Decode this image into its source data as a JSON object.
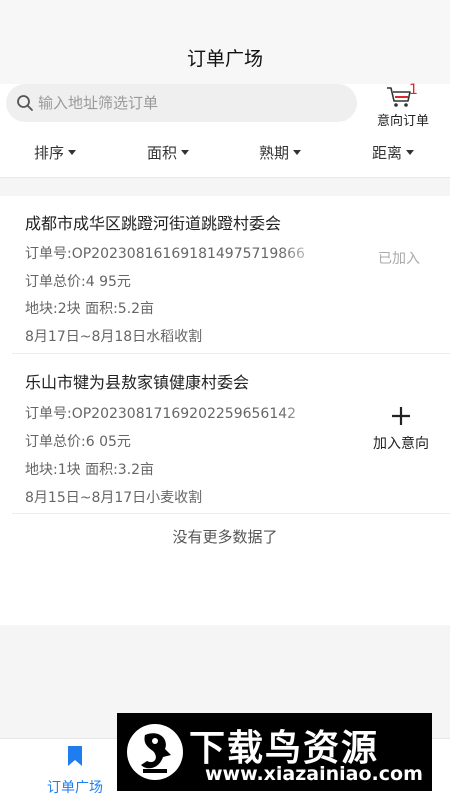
{
  "header": {
    "title": "订单广场"
  },
  "search": {
    "placeholder": "输入地址筛选订单"
  },
  "cart": {
    "badge": "1",
    "label": "意向订单"
  },
  "filters": [
    {
      "label": "排序"
    },
    {
      "label": "面积"
    },
    {
      "label": "熟期"
    },
    {
      "label": "距离"
    }
  ],
  "orders": [
    {
      "title": "成都市成华区跳蹬河街道跳蹬村委会",
      "order_no": "订单号:OP2023081616918149757198​66",
      "total": "订单总价:4 95元",
      "plots": "地块:2块 面积:5.2亩",
      "harvest": "8月17日~8月18日水稻收割",
      "status": "已加入"
    },
    {
      "title": "乐山市犍为县敖家镇健康村委会",
      "order_no": "订单号:OP202308171692022596561​42",
      "total": "订单总价:6 05元",
      "plots": "地块:1块 面积:3.2亩",
      "harvest": "8月15日~8月17日小麦收割",
      "action": "加入意向"
    }
  ],
  "list_footer": "没有更多数据了",
  "tabbar": {
    "tabs": [
      {
        "label": "订单广场"
      }
    ]
  },
  "watermark": {
    "title": "下载鸟资源",
    "url": "www.xiazainiao.com"
  },
  "colors": {
    "accent": "#1e7ef0",
    "badge": "#e3232d"
  }
}
